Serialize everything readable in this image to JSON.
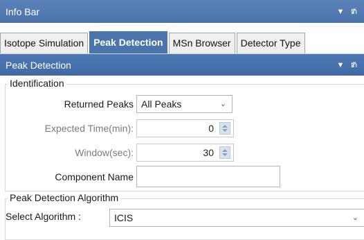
{
  "info_bar": {
    "title": "Info Bar",
    "pin_icon": "pin-icon",
    "dropdown_icon": "dropdown-arrow-icon"
  },
  "tabs": [
    {
      "label": "Isotope Simulation",
      "active": false
    },
    {
      "label": "Peak Detection",
      "active": true
    },
    {
      "label": "MSn Browser",
      "active": false
    },
    {
      "label": "Detector Type",
      "active": false
    }
  ],
  "panel": {
    "title": "Peak Detection"
  },
  "identification": {
    "legend": "Identification",
    "returned_peaks_label": "Returned Peaks",
    "returned_peaks_value": "All Peaks",
    "expected_time_label": "Expected Time(min):",
    "expected_time_value": "0",
    "window_label": "Window(sec):",
    "window_value": "30",
    "component_name_label": "Component Name",
    "component_name_value": ""
  },
  "algorithm": {
    "legend": "Peak Detection Algorithm",
    "select_label": "Select Algorithm :",
    "select_value": "ICIS"
  },
  "colors": {
    "title_bar": "#4a73ab",
    "active_tab": "#4b74ad"
  }
}
